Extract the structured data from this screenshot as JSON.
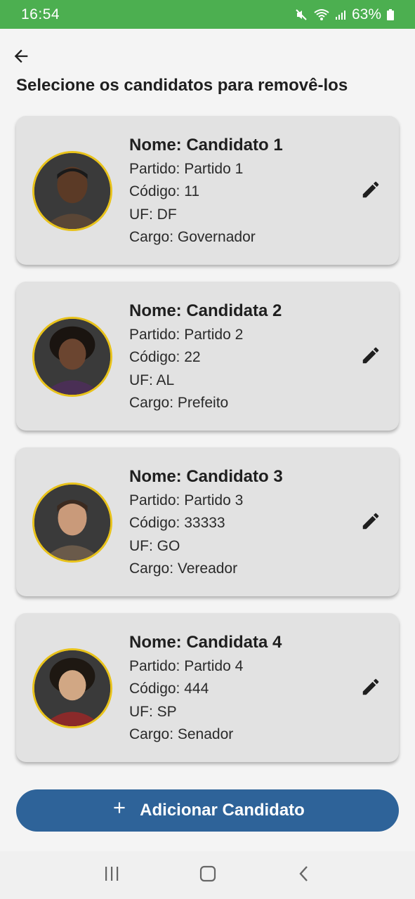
{
  "status": {
    "time": "16:54",
    "battery": "63%"
  },
  "header": {
    "title": "Selecione os candidatos para removê-los"
  },
  "candidates": [
    {
      "name": "Nome: Candidato 1",
      "party": "Partido: Partido 1",
      "code": "Código: 11",
      "state": "UF: DF",
      "role": "Cargo: Governador"
    },
    {
      "name": "Nome: Candidata 2",
      "party": "Partido: Partido 2",
      "code": "Código: 22",
      "state": "UF: AL",
      "role": "Cargo: Prefeito"
    },
    {
      "name": "Nome: Candidato 3",
      "party": "Partido: Partido 3",
      "code": "Código: 33333",
      "state": "UF: GO",
      "role": "Cargo: Vereador"
    },
    {
      "name": "Nome: Candidata 4",
      "party": "Partido: Partido 4",
      "code": "Código: 444",
      "state": "UF: SP",
      "role": "Cargo: Senador"
    }
  ],
  "actions": {
    "add_label": "Adicionar Candidato"
  },
  "colors": {
    "status_bar": "#4caf50",
    "card_bg": "#e2e2e2",
    "avatar_border": "#e8c21a",
    "primary_button": "#2e6399"
  },
  "icons": {
    "back": "arrow-left-icon",
    "edit": "pencil-icon",
    "add": "plus-icon",
    "nav_recent": "recent-apps-icon",
    "nav_home": "home-icon",
    "nav_back": "chevron-left-icon"
  }
}
